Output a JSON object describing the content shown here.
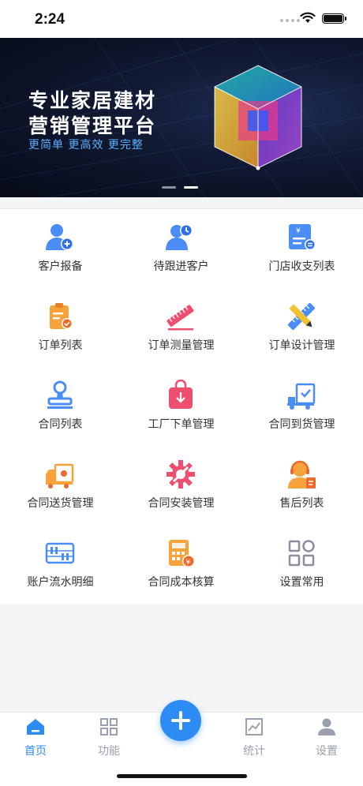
{
  "status": {
    "time": "2:24"
  },
  "banner": {
    "title_line1": "专业家居建材",
    "title_line2": "营销管理平台",
    "subtitle": "更简单 更高效 更完整"
  },
  "menu": {
    "items": [
      {
        "label": "客户报备",
        "icon": "customer-add-icon"
      },
      {
        "label": "待跟进客户",
        "icon": "customer-followup-icon"
      },
      {
        "label": "门店收支列表",
        "icon": "store-finance-icon"
      },
      {
        "label": "订单列表",
        "icon": "order-list-icon"
      },
      {
        "label": "订单测量管理",
        "icon": "ruler-icon"
      },
      {
        "label": "订单设计管理",
        "icon": "design-tools-icon"
      },
      {
        "label": "合同列表",
        "icon": "stamp-icon"
      },
      {
        "label": "工厂下单管理",
        "icon": "factory-bag-icon"
      },
      {
        "label": "合同到货管理",
        "icon": "delivery-arrival-icon"
      },
      {
        "label": "合同送货管理",
        "icon": "delivery-truck-icon"
      },
      {
        "label": "合同安装管理",
        "icon": "install-gear-icon"
      },
      {
        "label": "售后列表",
        "icon": "customer-service-icon"
      },
      {
        "label": "账户流水明细",
        "icon": "abacus-icon"
      },
      {
        "label": "合同成本核算",
        "icon": "calculator-icon"
      },
      {
        "label": "设置常用",
        "icon": "grid-settings-icon"
      }
    ]
  },
  "tabbar": {
    "home": "首页",
    "functions": "功能",
    "stats": "统计",
    "settings": "设置"
  },
  "colors": {
    "accent": "#2c8cf4",
    "inactive": "#9aa0ad"
  }
}
